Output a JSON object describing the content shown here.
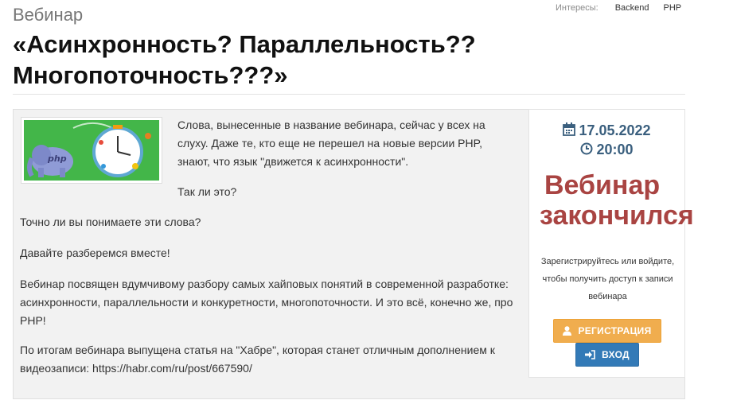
{
  "header": {
    "kicker": "Вебинар",
    "title": "«Асинхронность? Параллельность?? Многопоточность???»",
    "interests_label": "Интересы:",
    "interests": [
      "Backend",
      "PHP"
    ]
  },
  "description": {
    "p1": "Слова, вынесенные в название вебинара, сейчас у всех на слуху. Даже те, кто еще не перешел на новые версии PHP, знают, что язык \"движется к асинхронности\".",
    "p2": "Так ли это?",
    "p3": "Точно ли вы понимаете эти слова?",
    "p4": "Давайте разберемся вместе!",
    "p5": "Вебинар посвящен вдумчивому разбору самых хайповых понятий в современной разработке: асинхронности, параллельности и конкуретности, многопоточности. И это всё, конечно же, про PHP!",
    "p6": "По итогам вебинара выпущена статья на \"Хабре\", которая станет отличным дополнением к видеозаписи: https://habr.com/ru/post/667590/"
  },
  "sidebar": {
    "date": "17.05.2022",
    "time": "20:00",
    "status_line1": "Вебинар",
    "status_line2": "закончился",
    "register_note": "Зарегистрируйтесь или войдите, чтобы получить доступ к записи вебинара",
    "register_label": "РЕГИСТРАЦИЯ",
    "login_label": "ВХОД"
  },
  "icons": {
    "calendar": "calendar-icon",
    "clock": "clock-icon",
    "user": "user-icon",
    "sign_in": "sign-in-icon"
  },
  "colors": {
    "date_text": "#3a5f7e",
    "ended_text": "#a94442",
    "register_button": "#f0ad4e",
    "login_button": "#337ab7"
  }
}
